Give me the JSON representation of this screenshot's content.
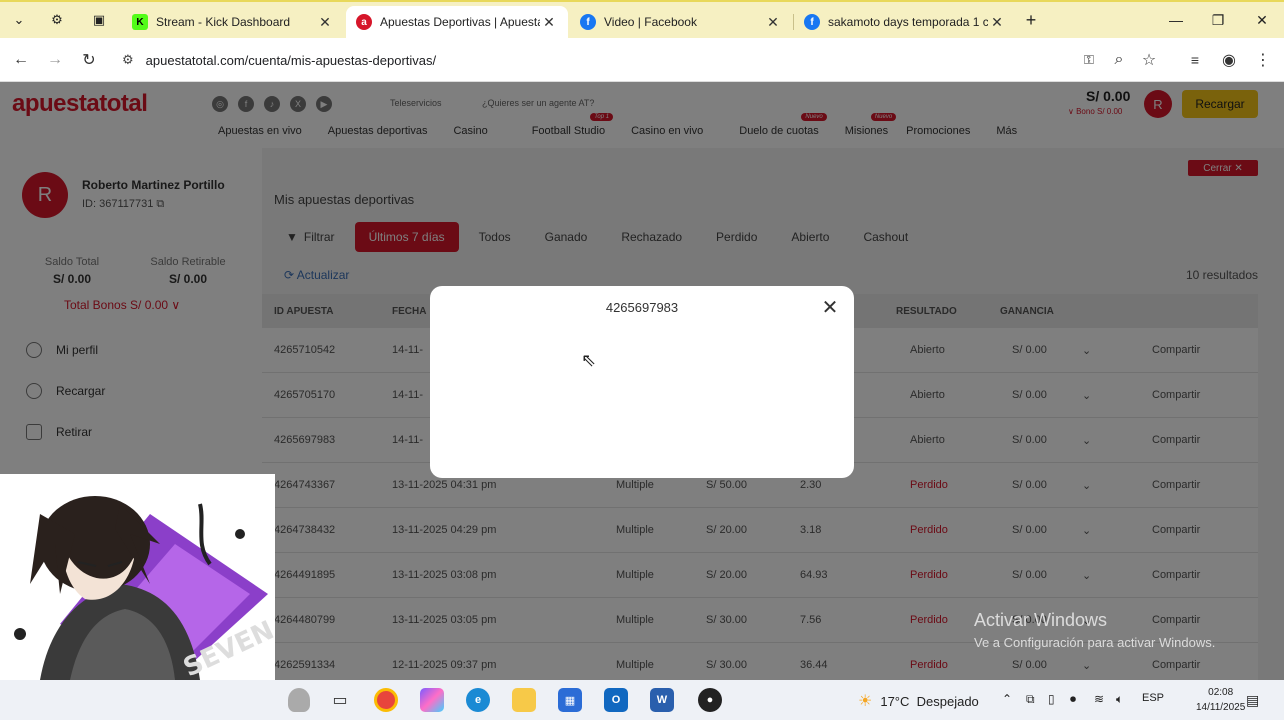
{
  "browser": {
    "tabs": [
      {
        "title": "Stream - Kick Dashboard",
        "favicon": "K",
        "color": "#53fc18",
        "active": false
      },
      {
        "title": "Apuestas Deportivas | Apuesta",
        "favicon": "a",
        "color": "#d6162a",
        "active": true
      },
      {
        "title": "Video | Facebook",
        "favicon": "f",
        "color": "#1877f2",
        "active": false
      },
      {
        "title": "sakamoto days temporada 1 ca",
        "favicon": "f",
        "color": "#1877f2",
        "active": false
      }
    ],
    "url": "apuestatotal.com/cuenta/mis-apuestas-deportivas/",
    "tab_close": "✕",
    "new_tab": "+"
  },
  "site": {
    "logo": "apuestatotal",
    "teleservicios": "Teleservicios",
    "agente": "¿Quieres ser un agente AT?",
    "nav": [
      {
        "label": "Apuestas en vivo",
        "badge": ""
      },
      {
        "label": "Apuestas deportivas",
        "badge": ""
      },
      {
        "label": "Casino",
        "badge": ""
      },
      {
        "label": "Football Studio",
        "badge": "Top 1"
      },
      {
        "label": "Casino en vivo",
        "badge": ""
      },
      {
        "label": "Duelo de cuotas",
        "badge": "Nuevo"
      },
      {
        "label": "Misiones",
        "badge": "Nuevo"
      },
      {
        "label": "Promociones",
        "badge": ""
      },
      {
        "label": "Más",
        "badge": ""
      }
    ],
    "balance": "S/ 0.00",
    "bono": "∨ Bono S/ 0.00",
    "avatar_initial": "R",
    "recargar": "Recargar",
    "cerrar": "Cerrar ✕"
  },
  "sidebar": {
    "avatar_initial": "R",
    "name": "Roberto Martinez Portillo",
    "id": "ID: 367117731",
    "saldo_total_label": "Saldo Total",
    "saldo_total": "S/ 0.00",
    "saldo_retirable_label": "Saldo Retirable",
    "saldo_retirable": "S/ 0.00",
    "total_bonos": "Total Bonos S/ 0.00 ∨",
    "items": [
      "Mi perfil",
      "Recargar",
      "Retirar"
    ]
  },
  "main": {
    "title": "Mis apuestas deportivas",
    "filtrar": "Filtrar",
    "filters": [
      "Últimos 7 días",
      "Todos",
      "Ganado",
      "Rechazado",
      "Perdido",
      "Abierto",
      "Cashout"
    ],
    "actualizar": "Actualizar",
    "resultados": "10 resultados",
    "headers": {
      "id": "ID APUESTA",
      "fecha": "FECHA",
      "resultado": "RESULTADO",
      "ganancia": "GANANCIA"
    },
    "compartir": "Compartir",
    "rows": [
      {
        "id": "4265710542",
        "fecha": "14-11-",
        "tipo": "",
        "monto": "",
        "cuota": "",
        "resultado": "Abierto",
        "ganancia": "S/ 0.00"
      },
      {
        "id": "4265705170",
        "fecha": "14-11-",
        "tipo": "",
        "monto": "",
        "cuota": "",
        "resultado": "Abierto",
        "ganancia": "S/ 0.00"
      },
      {
        "id": "4265697983",
        "fecha": "14-11-",
        "tipo": "",
        "monto": "",
        "cuota": "",
        "resultado": "Abierto",
        "ganancia": "S/ 0.00"
      },
      {
        "id": "4264743367",
        "fecha": "13-11-2025 04:31 pm",
        "tipo": "Multiple",
        "monto": "S/ 50.00",
        "cuota": "2.30",
        "resultado": "Perdido",
        "ganancia": "S/ 0.00"
      },
      {
        "id": "4264738432",
        "fecha": "13-11-2025 04:29 pm",
        "tipo": "Multiple",
        "monto": "S/ 20.00",
        "cuota": "3.18",
        "resultado": "Perdido",
        "ganancia": "S/ 0.00"
      },
      {
        "id": "4264491895",
        "fecha": "13-11-2025 03:08 pm",
        "tipo": "Multiple",
        "monto": "S/ 20.00",
        "cuota": "64.93",
        "resultado": "Perdido",
        "ganancia": "S/ 0.00"
      },
      {
        "id": "4264480799",
        "fecha": "13-11-2025 03:05 pm",
        "tipo": "Multiple",
        "monto": "S/ 30.00",
        "cuota": "7.56",
        "resultado": "Perdido",
        "ganancia": "S/ 0.00"
      },
      {
        "id": "4262591334",
        "fecha": "12-11-2025 09:37 pm",
        "tipo": "Multiple",
        "monto": "S/ 30.00",
        "cuota": "36.44",
        "resultado": "Perdido",
        "ganancia": "S/ 0.00"
      }
    ]
  },
  "modal": {
    "title": "4265697983",
    "close": "✕"
  },
  "overlay": {
    "art_text": "SEVEN"
  },
  "watermark": {
    "line1": "Activar Windows",
    "line2": "Ve a Configuración para activar Windows."
  },
  "taskbar": {
    "temperature": "17°C",
    "weather": "Despejado",
    "language": "ESP",
    "time": "02:08",
    "date": "14/11/2025"
  }
}
